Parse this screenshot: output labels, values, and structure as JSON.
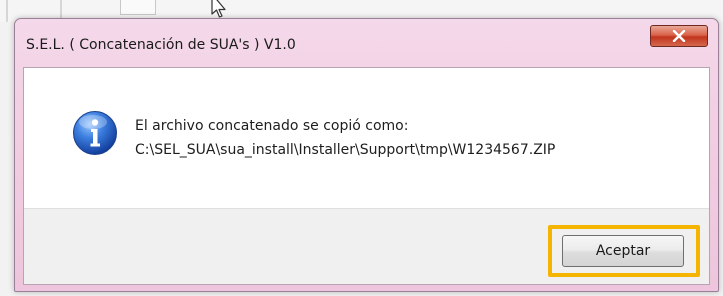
{
  "dialog": {
    "title": "S.E.L. ( Concatenación de SUA's ) V1.0",
    "close_icon": "close-icon",
    "info_icon": "information-icon",
    "message_line1": "El archivo concatenado se copió como:",
    "message_line2": "C:\\SEL_SUA\\sua_install\\Installer\\Support\\tmp\\W1234567.ZIP",
    "accept_label": "Aceptar",
    "highlight_color": "#f5b400",
    "close_button_color": "#c1341c",
    "frame_color": "#f2cfe3"
  },
  "cursor_icon": "mouse-pointer-icon"
}
